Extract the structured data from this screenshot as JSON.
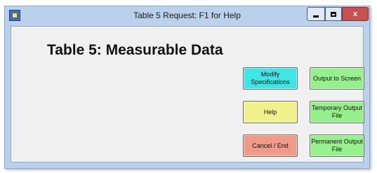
{
  "window": {
    "title": "Table 5 Request: F1 for Help",
    "close_label": "x"
  },
  "heading": "Table 5: Measurable Data",
  "buttons": {
    "modify": {
      "label": "Modify Specifications",
      "color": "#3ee6e6"
    },
    "output_screen": {
      "label": "Output to Screen",
      "color": "#96f08c"
    },
    "help": {
      "label": "Help",
      "color": "#f2f28a"
    },
    "temporary_output": {
      "label": "Temporary Output File",
      "color": "#96f08c"
    },
    "cancel_end": {
      "label": "Cancel / End",
      "color": "#f09a8a"
    },
    "permanent_output": {
      "label": "Permanent Output File",
      "color": "#96f08c"
    }
  }
}
